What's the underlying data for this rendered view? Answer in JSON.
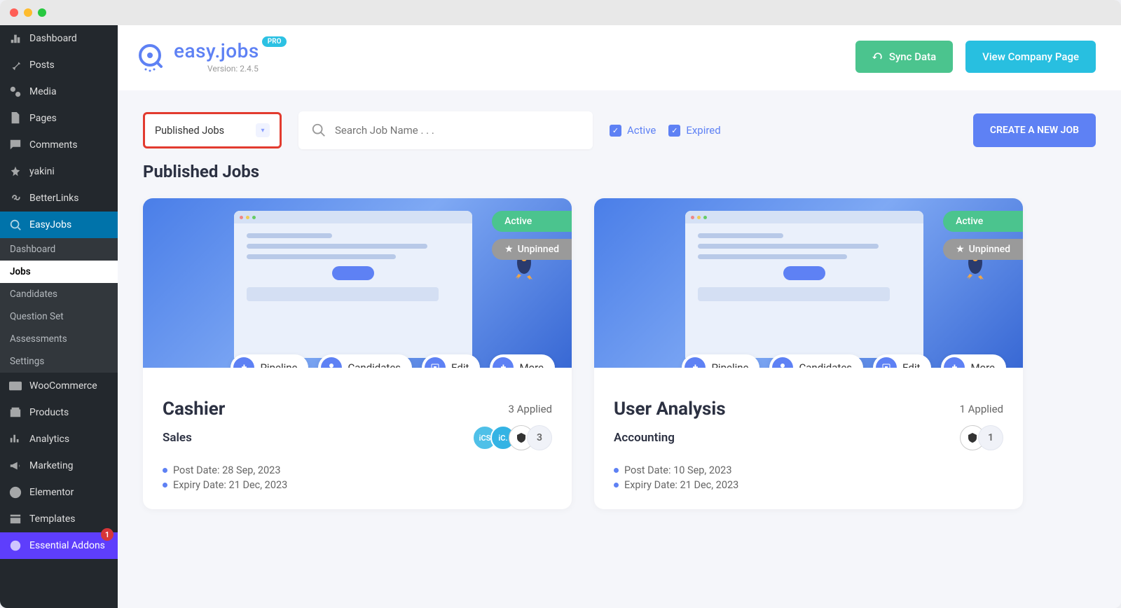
{
  "sidebar": {
    "items": [
      {
        "label": "Dashboard"
      },
      {
        "label": "Posts"
      },
      {
        "label": "Media"
      },
      {
        "label": "Pages"
      },
      {
        "label": "Comments"
      },
      {
        "label": "yakini"
      },
      {
        "label": "BetterLinks"
      },
      {
        "label": "EasyJobs"
      },
      {
        "label": "WooCommerce"
      },
      {
        "label": "Products"
      },
      {
        "label": "Analytics"
      },
      {
        "label": "Marketing"
      },
      {
        "label": "Elementor"
      },
      {
        "label": "Templates"
      },
      {
        "label": "Essential Addons"
      }
    ],
    "sub": [
      "Dashboard",
      "Jobs",
      "Candidates",
      "Question Set",
      "Assessments",
      "Settings"
    ],
    "ea_badge": "1"
  },
  "header": {
    "logo_text": "easy.jobs",
    "pro": "PRO",
    "version": "Version: 2.4.5",
    "sync": "Sync Data",
    "view_company": "View Company Page"
  },
  "filters": {
    "dropdown": "Published Jobs",
    "search_placeholder": "Search Job Name . . .",
    "active": "Active",
    "expired": "Expired",
    "create": "CREATE A NEW JOB"
  },
  "section_title": "Published Jobs",
  "pills": {
    "pipeline": "Pipeline",
    "candidates": "Candidates",
    "edit": "Edit",
    "more": "More"
  },
  "chips": {
    "active": "Active",
    "unpinned": "Unpinned"
  },
  "jobs": [
    {
      "title": "Cashier",
      "category": "Sales",
      "applied": "3 Applied",
      "avatar_count": "3",
      "post_date": "Post Date: 28 Sep, 2023",
      "expiry_date": "Expiry Date: 21 Dec, 2023"
    },
    {
      "title": "User Analysis",
      "category": "Accounting",
      "applied": "1 Applied",
      "avatar_count": "1",
      "post_date": "Post Date: 10 Sep, 2023",
      "expiry_date": "Expiry Date: 21 Dec, 2023"
    }
  ]
}
